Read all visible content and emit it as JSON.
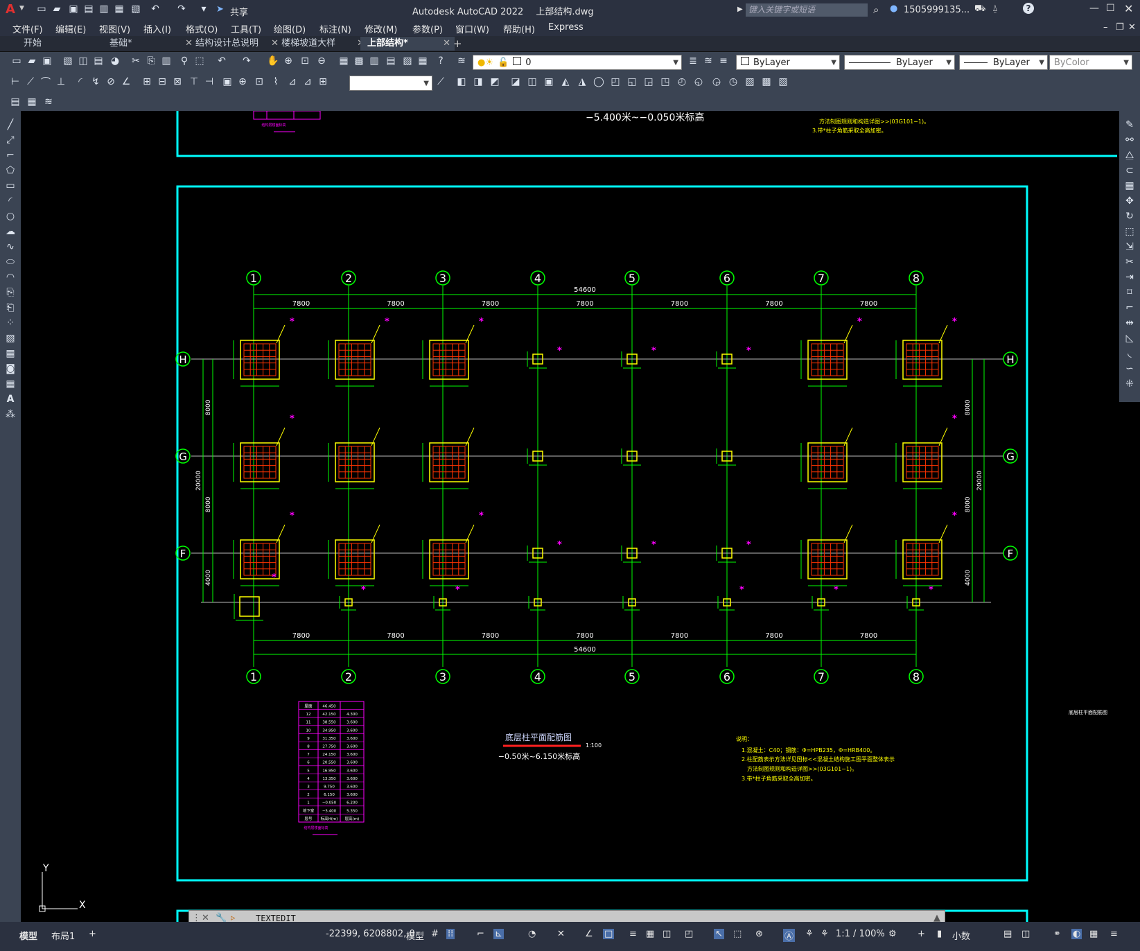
{
  "titlebar": {
    "app_title": "Autodesk AutoCAD 2022",
    "file_name": "上部结构.dwg",
    "share_label": "共享",
    "search_placeholder": "键入关键字或短语",
    "user": "1505999135...",
    "logo": "A"
  },
  "menu": [
    "文件(F)",
    "编辑(E)",
    "视图(V)",
    "插入(I)",
    "格式(O)",
    "工具(T)",
    "绘图(D)",
    "标注(N)",
    "修改(M)",
    "参数(P)",
    "窗口(W)",
    "帮助(H)",
    "Express"
  ],
  "tabs": [
    {
      "label": "开始",
      "closable": false,
      "active": false
    },
    {
      "label": "基础*",
      "closable": true,
      "active": false
    },
    {
      "label": "结构设计总说明",
      "closable": true,
      "active": false
    },
    {
      "label": "楼梯坡道大样",
      "closable": true,
      "active": false
    },
    {
      "label": "上部结构*",
      "closable": true,
      "active": true
    }
  ],
  "layer_combo": "0",
  "color_combo": "ByLayer",
  "linetype_combo": "ByLayer",
  "lineweight_combo": "ByLayer",
  "plotstyle_combo": "ByColor",
  "drawing": {
    "top_title_height": "−5.400米~−0.050米标高",
    "top_notes": [
      "方法制图规则和构造详图>>(03G101−1)。",
      "3.带*柱子角筋采取全高加密。"
    ],
    "axes_x": [
      "1",
      "2",
      "3",
      "4",
      "5",
      "6",
      "7",
      "8"
    ],
    "axes_y": [
      "H",
      "G",
      "F"
    ],
    "bay_dims": [
      "7800",
      "7800",
      "7800",
      "7800",
      "7800",
      "7800",
      "7800"
    ],
    "total_dim": "54600",
    "side_dims": [
      "8000",
      "8000",
      "4000"
    ],
    "side_total": "20000",
    "plan_title": "底层柱平面配筋图",
    "plan_scale": "1:100",
    "plan_height": "−0.50米~6.150米标高",
    "notes_title": "说明：",
    "notes": [
      "1.混凝土：C40；钢筋：Φ=HPB235，Φ=HRB400。",
      "2.柱配筋表示方法详见国标<<混凝土结构施工图平面整体表示",
      "方法制图规则和构造详图>>(03G101−1)。",
      "3.带*柱子角筋采取全高加密。"
    ],
    "right_label": "底层柱平面配筋图",
    "floor_table": {
      "rows": [
        [
          "屋面",
          "46.450",
          ""
        ],
        [
          "12",
          "42.150",
          "4.300"
        ],
        [
          "11",
          "38.550",
          "3.600"
        ],
        [
          "10",
          "34.950",
          "3.600"
        ],
        [
          "9",
          "31.350",
          "3.600"
        ],
        [
          "8",
          "27.750",
          "3.600"
        ],
        [
          "7",
          "24.150",
          "3.600"
        ],
        [
          "6",
          "20.550",
          "3.600"
        ],
        [
          "5",
          "16.950",
          "3.600"
        ],
        [
          "4",
          "13.350",
          "3.600"
        ],
        [
          "3",
          "9.750",
          "3.600"
        ],
        [
          "2",
          "6.150",
          "3.600"
        ],
        [
          "1",
          "−0.050",
          "6.200"
        ],
        [
          "地下室",
          "−5.400",
          "5.350"
        ],
        [
          "层号",
          "标高H(m)",
          "层高(m)"
        ]
      ],
      "caption": "结构层楼面标高"
    },
    "top_table_caption": "结构层楼面标高"
  },
  "ucs": {
    "x": "X",
    "y": "Y"
  },
  "command_text": "TEXTEDIT",
  "layout_tabs": [
    "模型",
    "布局1"
  ],
  "status": {
    "coords": "-22399, 6208802, 0",
    "model": "模型",
    "scale": "1:1 / 100%",
    "units": "小数"
  },
  "colors": {
    "frame": "#00ffff",
    "axis": "#00ff00",
    "column_outline": "#ffff00",
    "rebar": "#ff3300",
    "marker": "#ff00ff",
    "text": "#ffffff"
  }
}
